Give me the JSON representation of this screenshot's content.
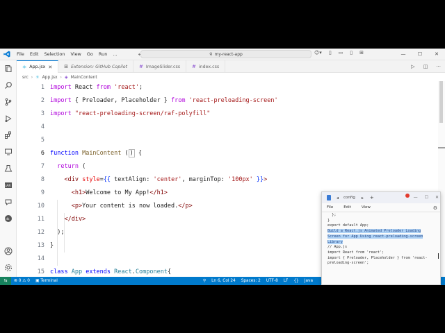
{
  "menu": [
    "File",
    "Edit",
    "Selection",
    "View",
    "Go",
    "Run",
    "..."
  ],
  "command_center": "my-react-app",
  "tabs": [
    {
      "label": "App.jsx",
      "icon": "react-icon",
      "active": true
    },
    {
      "label": "Extension: GitHub Copilot",
      "icon": "extension-icon",
      "active": false
    },
    {
      "label": "ImageSlider.css",
      "icon": "css-icon",
      "active": false
    },
    {
      "label": "index.css",
      "icon": "css-icon",
      "active": false
    }
  ],
  "breadcrumb": [
    "src",
    "App.jsx",
    "MainContent"
  ],
  "code_lines": [
    {
      "n": "1",
      "text": "import React from 'react';"
    },
    {
      "n": "2",
      "text": "import { Preloader, Placeholder } from 'react-preloading-screen'"
    },
    {
      "n": "3",
      "text": "import \"react-preloading-screen/raf-polyfill\""
    },
    {
      "n": "4",
      "text": ""
    },
    {
      "n": "5",
      "text": ""
    },
    {
      "n": "6",
      "text": "function MainContent () {"
    },
    {
      "n": "7",
      "text": "  return ("
    },
    {
      "n": "8",
      "text": "    <div style={{ textAlign: 'center', marginTop: '100px' }}>"
    },
    {
      "n": "9",
      "text": "      <h1>Welcome to My App!</h1>"
    },
    {
      "n": "10",
      "text": "      <p>Your content is now loaded.</p>"
    },
    {
      "n": "11",
      "text": "    </div>"
    },
    {
      "n": "12",
      "text": "  );"
    },
    {
      "n": "13",
      "text": "}"
    },
    {
      "n": "14",
      "text": ""
    },
    {
      "n": "15",
      "text": "class App extends React.Component{"
    }
  ],
  "status": {
    "errors": "0",
    "warnings": "0",
    "terminal": "Terminal",
    "position": "Ln 6, Col 24",
    "spaces": "Spaces: 2",
    "encoding": "UTF-8",
    "eol": "LF",
    "language": "Java"
  },
  "notepad": {
    "tab_title": "config",
    "menu": [
      "File",
      "Edit",
      "View"
    ],
    "lines_before": [
      "  };",
      "}",
      "",
      "export default App;",
      ""
    ],
    "highlight": [
      "Build a React.js Animated Preloader Loading",
      "Screen for App Using react-preloading-screen",
      "Library"
    ],
    "lines_after": [
      "",
      "",
      "// App.js",
      "import React from 'react';",
      "import { Preloader, Placeholder } from 'react-",
      "preloading-screen';"
    ]
  },
  "colors": {
    "accent": "#007acc",
    "remote": "#16825d",
    "keyword": "#af00db",
    "string": "#a31515",
    "tag": "#800000"
  }
}
